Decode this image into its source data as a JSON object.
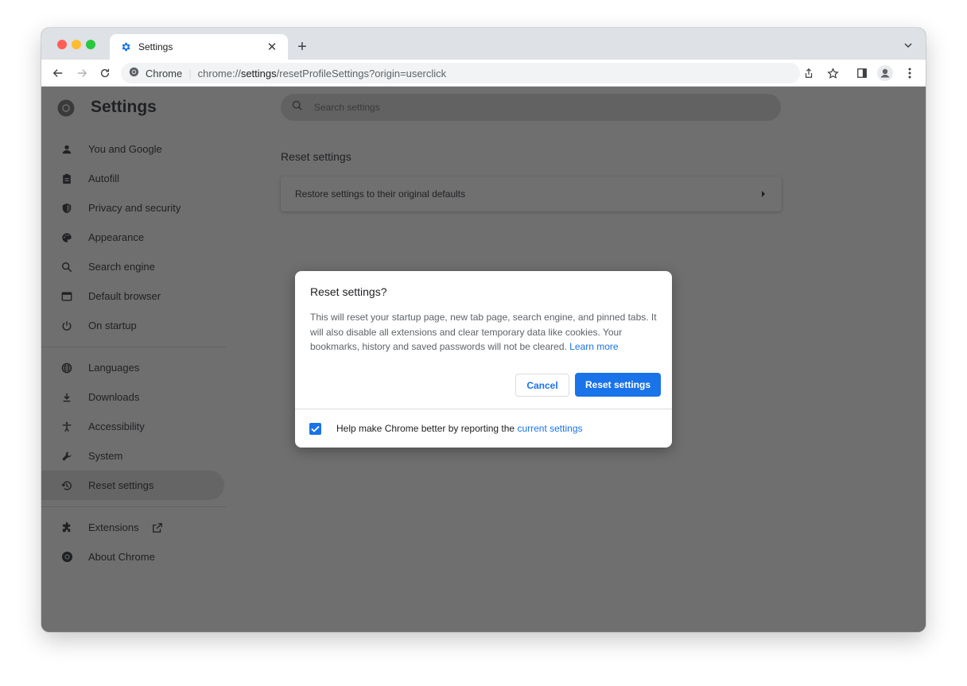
{
  "tab": {
    "title": "Settings",
    "close_label": "✕",
    "new_tab_label": "+"
  },
  "omnibox": {
    "site_name": "Chrome",
    "separator": "|",
    "url_scheme": "chrome://",
    "url_host": "settings",
    "url_path": "/resetProfileSettings?origin=userclick"
  },
  "page": {
    "title": "Settings",
    "search_placeholder": "Search settings",
    "section_title": "Reset settings",
    "card_label": "Restore settings to their original defaults"
  },
  "sidebar": {
    "items": [
      {
        "label": "You and Google",
        "icon": "person-icon"
      },
      {
        "label": "Autofill",
        "icon": "clipboard-icon"
      },
      {
        "label": "Privacy and security",
        "icon": "shield-icon"
      },
      {
        "label": "Appearance",
        "icon": "palette-icon"
      },
      {
        "label": "Search engine",
        "icon": "search-icon"
      },
      {
        "label": "Default browser",
        "icon": "browser-icon"
      },
      {
        "label": "On startup",
        "icon": "power-icon"
      },
      {
        "label": "Languages",
        "icon": "globe-icon"
      },
      {
        "label": "Downloads",
        "icon": "download-icon"
      },
      {
        "label": "Accessibility",
        "icon": "accessibility-icon"
      },
      {
        "label": "System",
        "icon": "wrench-icon"
      },
      {
        "label": "Reset settings",
        "icon": "restore-icon",
        "active": true
      },
      {
        "label": "Extensions",
        "icon": "puzzle-icon"
      },
      {
        "label": "About Chrome",
        "icon": "chrome-icon"
      }
    ]
  },
  "dialog": {
    "title": "Reset settings?",
    "body": "This will reset your startup page, new tab page, search engine, and pinned tabs. It will also disable all extensions and clear temporary data like cookies. Your bookmarks, history and saved passwords will not be cleared.",
    "learn_more": "Learn more",
    "cancel_label": "Cancel",
    "reset_label": "Reset settings",
    "footer_text": "Help make Chrome better by reporting the",
    "footer_link": "current settings",
    "checkbox_checked": true
  },
  "colors": {
    "accent": "#1a73e8",
    "overlay": "#6f6f6f",
    "tabstrip": "#dee1e6"
  }
}
